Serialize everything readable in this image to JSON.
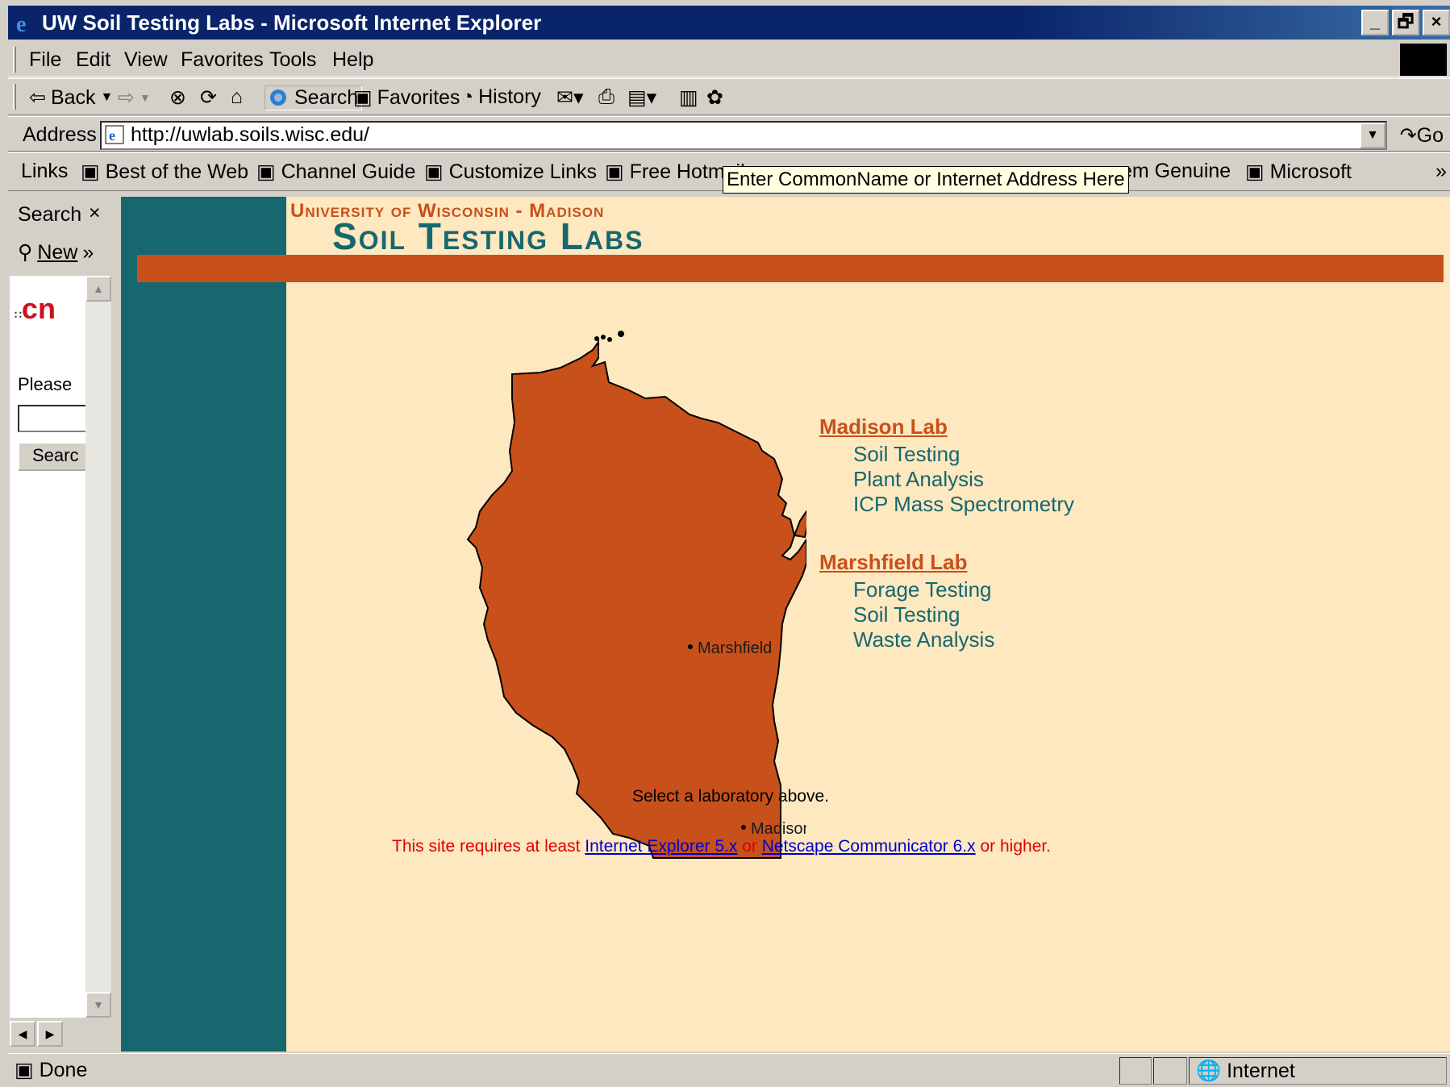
{
  "window": {
    "title": "UW Soil Testing Labs - Microsoft Internet Explorer",
    "min": "_",
    "max": "🗗",
    "close": "×"
  },
  "menu": {
    "items": [
      "File",
      "Edit",
      "View",
      "Favorites",
      "Tools",
      "Help"
    ]
  },
  "toolbar": {
    "back": "Back",
    "search": "Search",
    "favorites": "Favorites",
    "history": "History"
  },
  "address": {
    "label": "Address",
    "url": "http://uwlab.soils.wisc.edu/",
    "go": "Go"
  },
  "links": {
    "label": "Links",
    "items": [
      "Best of the Web",
      "Channel Guide",
      "Customize Links",
      "Free Hotmail",
      "em Genuine",
      "Microsoft"
    ]
  },
  "tooltip": "Enter CommonName or Internet Address Here",
  "explorer": {
    "title": "Search",
    "close": "×",
    "new": "New",
    "more": "»",
    "logo_text": "cn",
    "prompt": "Please",
    "button": "Searc"
  },
  "page": {
    "university": "University of Wisconsin - Madison",
    "title": "Soil Testing Labs",
    "map_labels": {
      "marshfield": "Marshfield",
      "madison": "Madison"
    },
    "madison_lab": {
      "heading": "Madison Lab",
      "items": [
        "Soil Testing",
        "Plant Analysis",
        "ICP Mass Spectrometry"
      ]
    },
    "marshfield_lab": {
      "heading": "Marshfield Lab",
      "items": [
        "Forage Testing",
        "Soil Testing",
        "Waste Analysis"
      ]
    },
    "select_note": "Select a laboratory above.",
    "requirement": {
      "prefix": "This site requires at least ",
      "ie_link": "Internet Explorer 5.x",
      "or": " or ",
      "ns_link": "Netscape Communicator 6.x",
      "suffix": " or higher."
    },
    "colors": {
      "teal": "#17676f",
      "orange": "#c8501a",
      "background": "#fde8c0"
    }
  },
  "status": {
    "text": "Done",
    "zone": "Internet"
  }
}
